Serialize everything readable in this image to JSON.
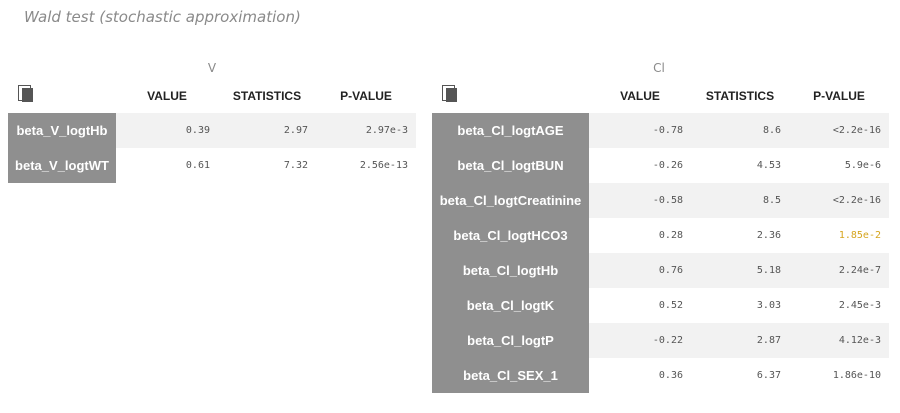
{
  "title": "Wald test (stochastic approximation)",
  "colors": {
    "name_bg": "#8f8f8f",
    "shade": "#f2f2f2",
    "highlight": "#d6a51e"
  },
  "headers": {
    "value": "VALUE",
    "statistics": "STATISTICS",
    "pvalue": "P-VALUE"
  },
  "left": {
    "group": "V",
    "rows": [
      {
        "name": "beta_V_logtHb",
        "value": "0.39",
        "stat": "2.97",
        "p": "2.97e-3"
      },
      {
        "name": "beta_V_logtWT",
        "value": "0.61",
        "stat": "7.32",
        "p": "2.56e-13"
      }
    ]
  },
  "right": {
    "group": "Cl",
    "rows": [
      {
        "name": "beta_Cl_logtAGE",
        "value": "-0.78",
        "stat": "8.6",
        "p": "<2.2e-16"
      },
      {
        "name": "beta_Cl_logtBUN",
        "value": "-0.26",
        "stat": "4.53",
        "p": "5.9e-6"
      },
      {
        "name": "beta_Cl_logtCreatinine",
        "value": "-0.58",
        "stat": "8.5",
        "p": "<2.2e-16"
      },
      {
        "name": "beta_Cl_logtHCO3",
        "value": "0.28",
        "stat": "2.36",
        "p": "1.85e-2",
        "highlight": true
      },
      {
        "name": "beta_Cl_logtHb",
        "value": "0.76",
        "stat": "5.18",
        "p": "2.24e-7"
      },
      {
        "name": "beta_Cl_logtK",
        "value": "0.52",
        "stat": "3.03",
        "p": "2.45e-3"
      },
      {
        "name": "beta_Cl_logtP",
        "value": "-0.22",
        "stat": "2.87",
        "p": "4.12e-3"
      },
      {
        "name": "beta_Cl_SEX_1",
        "value": "0.36",
        "stat": "6.37",
        "p": "1.86e-10"
      }
    ]
  }
}
